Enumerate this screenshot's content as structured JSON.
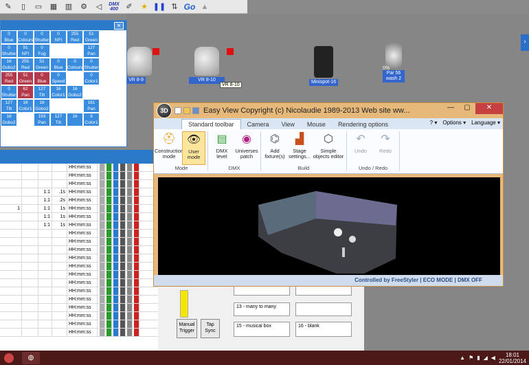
{
  "toolbar": {
    "dmx_label": "DMX 400",
    "go_label": "Go"
  },
  "stage": {
    "fixtures": [
      {
        "label": "VR 8-9"
      },
      {
        "label": "VR 8-10"
      },
      {
        "label": "Minispot-16"
      },
      {
        "label": "Par 56 wash 2"
      }
    ],
    "tooltip": "VR 8-10",
    "par_percent": "0%"
  },
  "dmx_panel": {
    "rows": [
      [
        "Blue",
        "Colours",
        "Shutter",
        "NFI",
        "Red",
        "Green",
        ""
      ],
      [
        "Shutter",
        "NFI",
        "Fog",
        "",
        "",
        "Pan",
        ""
      ],
      [
        "Gobo2",
        "Red",
        "Green",
        "Blue",
        "Colours",
        "Shutter",
        ""
      ],
      [
        "Red",
        "Green",
        "Blue",
        "Speed",
        "",
        "Color1",
        ""
      ],
      [
        "Shutter",
        "Pan",
        "Tilt",
        "Color1",
        "Gobo2",
        "",
        ""
      ],
      [
        "Tilt",
        "Color1",
        "Gobo2",
        "",
        "",
        "Pan",
        ""
      ],
      [
        "Gobo2",
        "",
        "Pan",
        "Tilt",
        "",
        "Color1",
        ""
      ]
    ],
    "values": [
      [
        "0",
        "0",
        "0",
        "0",
        "255",
        "51",
        ""
      ],
      [
        "0",
        "91",
        "0",
        "",
        "",
        "127",
        ""
      ],
      [
        "16",
        "255",
        "51",
        "0",
        "0",
        "0",
        ""
      ],
      [
        "255",
        "51",
        "0",
        "0",
        "",
        "0",
        ""
      ],
      [
        "0",
        "62",
        "127",
        "16",
        "16",
        "",
        ""
      ],
      [
        "127",
        "16",
        "16",
        "",
        "",
        "161",
        ""
      ],
      [
        "16",
        "",
        "193",
        "127",
        "16",
        "9",
        ""
      ]
    ]
  },
  "sequence": {
    "rows": [
      {
        "name": "",
        "a": "",
        "b": "",
        "time": "HH:mm:ss"
      },
      {
        "name": "",
        "a": "",
        "b": "",
        "time": "HH:mm:ss"
      },
      {
        "name": "",
        "a": "",
        "b": "",
        "time": "HH:mm:ss"
      },
      {
        "name": "",
        "a": "1:1",
        "b": ".1s",
        "time": "HH:mm:ss"
      },
      {
        "name": "",
        "a": "1:1",
        "b": ".2s",
        "time": "HH:mm:ss"
      },
      {
        "name": "1",
        "a": "1:1",
        "b": "1s",
        "time": "HH:mm:ss"
      },
      {
        "name": "",
        "a": "1:1",
        "b": "1s",
        "time": "HH:mm:ss"
      },
      {
        "name": "",
        "a": "1:1",
        "b": "1s",
        "time": "HH:mm:ss"
      },
      {
        "name": "",
        "a": "",
        "b": "",
        "time": "HH:mm:ss"
      },
      {
        "name": "",
        "a": "",
        "b": "",
        "time": "HH:mm:ss"
      },
      {
        "name": "",
        "a": "",
        "b": "",
        "time": "HH:mm:ss"
      },
      {
        "name": "",
        "a": "",
        "b": "",
        "time": "HH:mm:ss"
      },
      {
        "name": "",
        "a": "",
        "b": "",
        "time": "HH:mm:ss"
      },
      {
        "name": "",
        "a": "",
        "b": "",
        "time": "HH:mm:ss"
      },
      {
        "name": "",
        "a": "",
        "b": "",
        "time": "HH:mm:ss"
      },
      {
        "name": "",
        "a": "",
        "b": "",
        "time": "HH:mm:ss"
      },
      {
        "name": "",
        "a": "",
        "b": "",
        "time": "HH:mm:ss"
      },
      {
        "name": "",
        "a": "",
        "b": "",
        "time": "HH:mm:ss"
      },
      {
        "name": "",
        "a": "",
        "b": "",
        "time": "HH:mm:ss"
      },
      {
        "name": "",
        "a": "",
        "b": "",
        "time": "HH:mm:ss"
      },
      {
        "name": "",
        "a": "",
        "b": "",
        "time": "HH:mm:ss"
      }
    ]
  },
  "cues": {
    "manual_trigger": "Manual Trigger",
    "tap_sync": "Tap Sync",
    "cue_13": "13 - many to many",
    "cue_15": "15 - musical box",
    "cue_16": "16 - blank"
  },
  "easy_view": {
    "title": "Easy View   Copyright (c) Nicolaudie 1989-2013   Web site ww...",
    "logo": "3D",
    "tabs": [
      "Standard toolbar",
      "Camera",
      "View",
      "Mouse",
      "Rendering options"
    ],
    "right_menus": {
      "help": "? ▾",
      "options": "Options ▾",
      "language": "Language ▾"
    },
    "groups": [
      {
        "name": "Mode",
        "items": [
          "Construction mode",
          "User mode"
        ]
      },
      {
        "name": "DMX",
        "items": [
          "DMX level",
          "Universes patch"
        ]
      },
      {
        "name": "Build",
        "items": [
          "Add fixture(s)",
          "Stage settings...",
          "Simple objects editor"
        ]
      },
      {
        "name": "Undo / Redo",
        "items": [
          "Undo",
          "Redo"
        ]
      }
    ],
    "status": "Controlled by FreeStyler  |  ECO MODE  |  DMX OFF"
  },
  "taskbar": {
    "time": "18:01",
    "date": "22/01/2014"
  }
}
